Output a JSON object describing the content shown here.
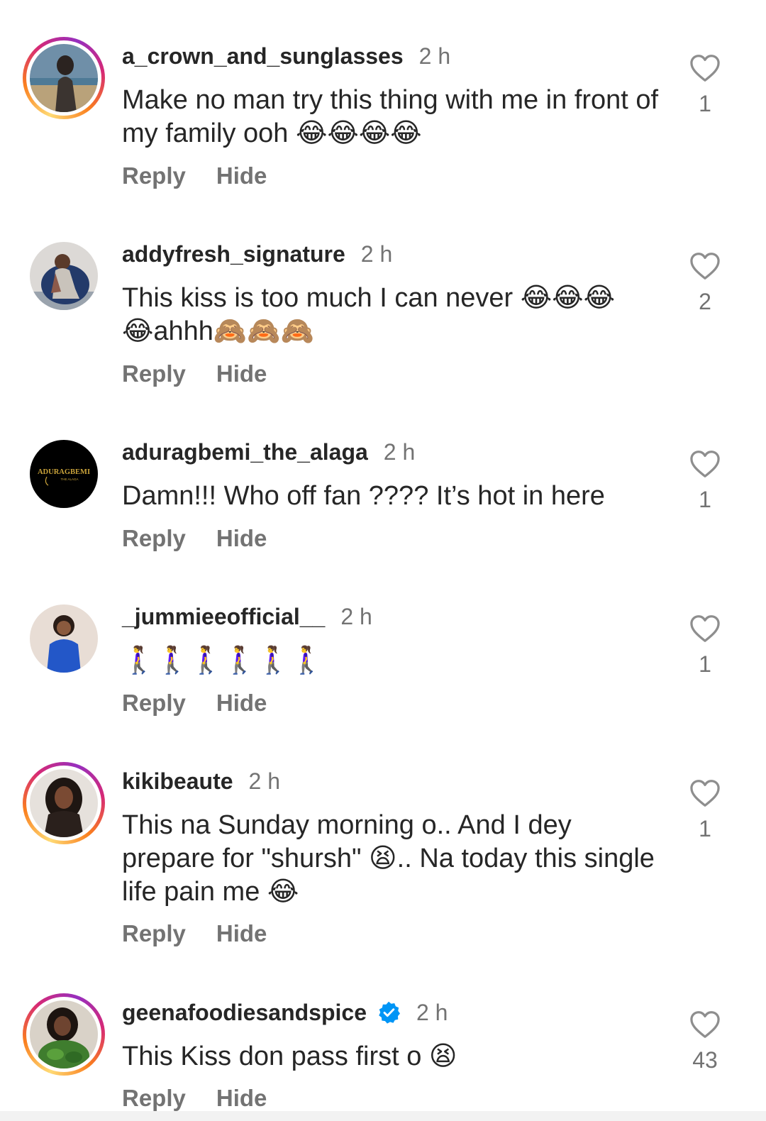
{
  "comments": [
    {
      "username": "a_crown_and_sunglasses",
      "time": "2 h",
      "text": "Make no man try this thing with me in front of my family ooh 😂😂😂😂",
      "likes": "1",
      "reply_label": "Reply",
      "hide_label": "Hide",
      "story_ring": true,
      "verified": false
    },
    {
      "username": "addyfresh_signature",
      "time": "2 h",
      "text": "This kiss is too much I can never 😂😂😂\n😂ahhh🙈🙈🙈",
      "likes": "2",
      "reply_label": "Reply",
      "hide_label": "Hide",
      "story_ring": false,
      "verified": false
    },
    {
      "username": "aduragbemi_the_alaga",
      "time": "2 h",
      "text": "Damn!!! Who off fan ???? It’s hot in here",
      "likes": "1",
      "reply_label": "Reply",
      "hide_label": "Hide",
      "story_ring": false,
      "verified": false,
      "avatar_text": "ADURAGBEMI",
      "avatar_subtext": "THE ALAGA"
    },
    {
      "username": "_jummieeofficial__",
      "time": "2 h",
      "text": "🚶‍♀️🚶‍♀️🚶‍♀️🚶‍♀️🚶‍♀️🚶‍♀️",
      "likes": "1",
      "reply_label": "Reply",
      "hide_label": "Hide",
      "story_ring": false,
      "verified": false
    },
    {
      "username": "kikibeaute",
      "time": "2 h",
      "text": "This na Sunday morning o.. And I dey prepare for \"shursh\" 😫.. Na today this single life pain me 😂",
      "likes": "1",
      "reply_label": "Reply",
      "hide_label": "Hide",
      "story_ring": true,
      "verified": false
    },
    {
      "username": "geenafoodiesandspice",
      "time": "2 h",
      "text": "This Kiss don pass first o 😫",
      "likes": "43",
      "reply_label": "Reply",
      "hide_label": "Hide",
      "story_ring": true,
      "verified": true
    }
  ],
  "icons": {
    "like": "heart-outline-icon",
    "verified": "verified-badge-icon"
  },
  "colors": {
    "text": "#262626",
    "secondary": "#737373",
    "verified": "#0095f6"
  }
}
